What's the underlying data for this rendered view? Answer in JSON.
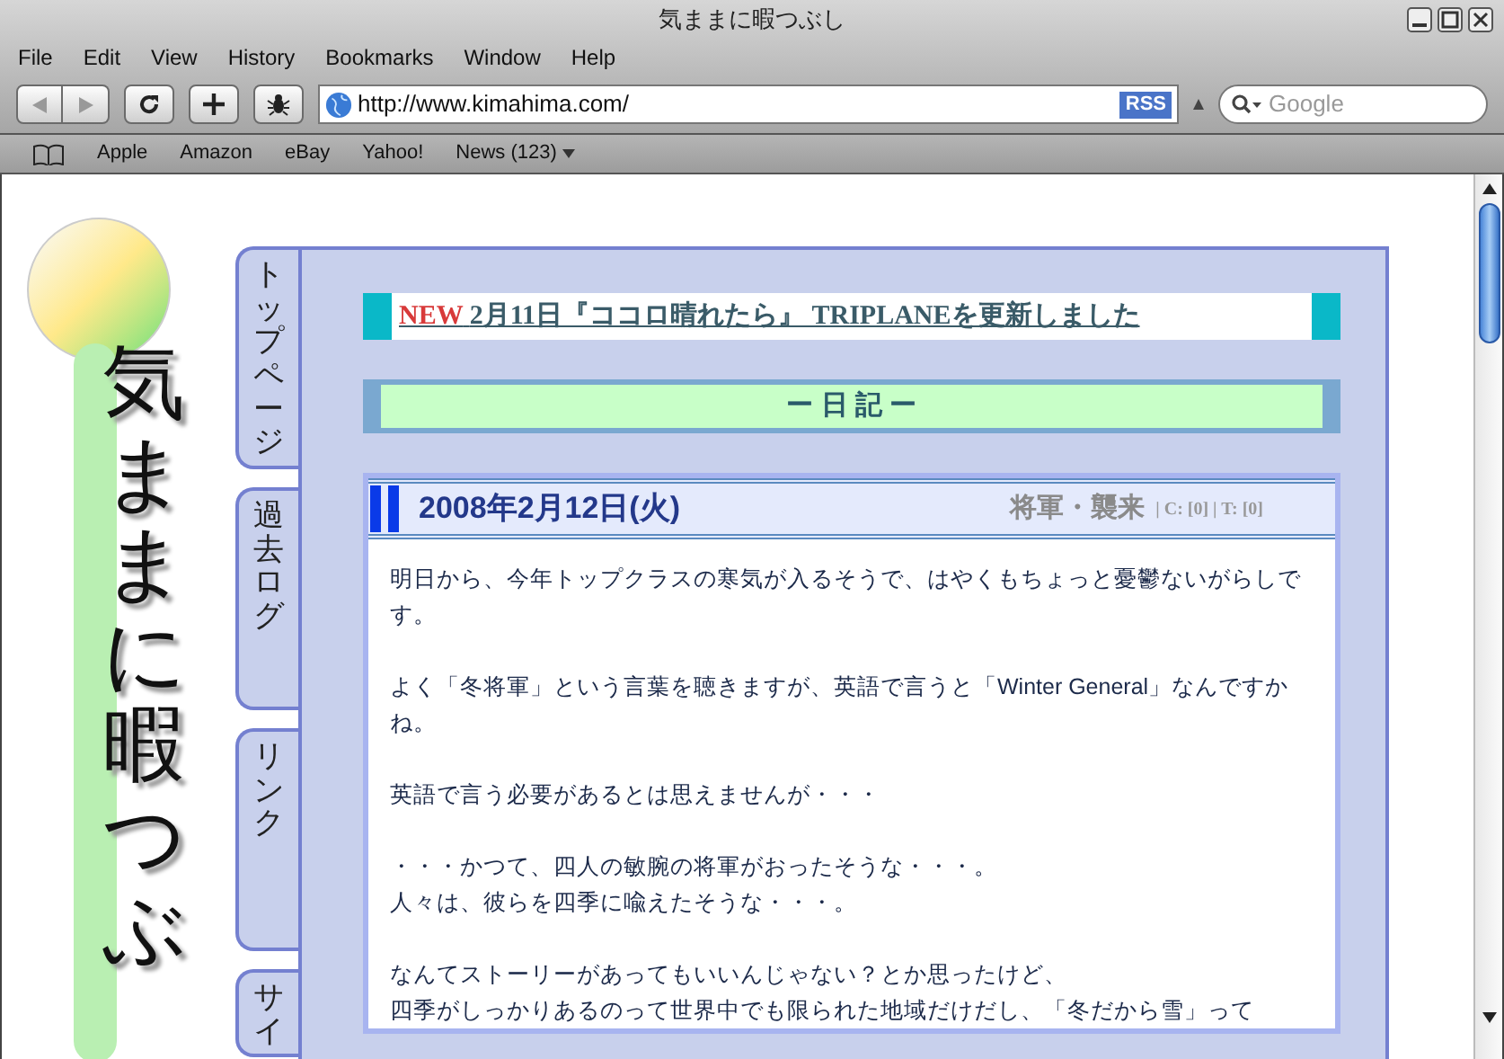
{
  "window": {
    "title": "気ままに暇つぶし"
  },
  "menu": [
    "File",
    "Edit",
    "View",
    "History",
    "Bookmarks",
    "Window",
    "Help"
  ],
  "address": {
    "value": "http://www.kimahima.com/",
    "badge": "RSS"
  },
  "search": {
    "placeholder": "Google"
  },
  "bookmarks": [
    {
      "label": "Apple",
      "kind": "link"
    },
    {
      "label": "Amazon",
      "kind": "link"
    },
    {
      "label": "eBay",
      "kind": "link"
    },
    {
      "label": "Yahoo!",
      "kind": "link"
    },
    {
      "label": "News (123)",
      "kind": "menu"
    }
  ],
  "logo": {
    "text": "気ままに暇つぶ"
  },
  "side_tabs": [
    "トップページ",
    "過去ログ",
    "リンク",
    "サイ"
  ],
  "news": {
    "badge": "NEW",
    "text": "2月11日『ココロ晴れたら』 TRIPLANEを更新しました"
  },
  "section_title": "ー 日 記 ー",
  "entry": {
    "date": "2008年2月12日(火)",
    "title": "将軍・襲来",
    "meta": "| C: [0] | T: [0]",
    "paragraphs": [
      [
        "明日から、今年トップクラスの寒気が入るそうで、はやくもちょっと憂鬱ないがらしです。"
      ],
      [
        "よく「冬将軍」という言葉を聴きますが、英語で言うと「Winter General」なんですかね。"
      ],
      [
        "英語で言う必要があるとは思えませんが・・・"
      ],
      [
        "・・・かつて、四人の敏腕の将軍がおったそうな・・・。",
        "人々は、彼らを四季に喩えたそうな・・・。"
      ],
      [
        "なんてストーリーがあってもいいんじゃない？とか思ったけど、",
        "四季がしっかりあるのって世界中でも限られた地域だけだし、「冬だから雪」って"
      ]
    ]
  }
}
